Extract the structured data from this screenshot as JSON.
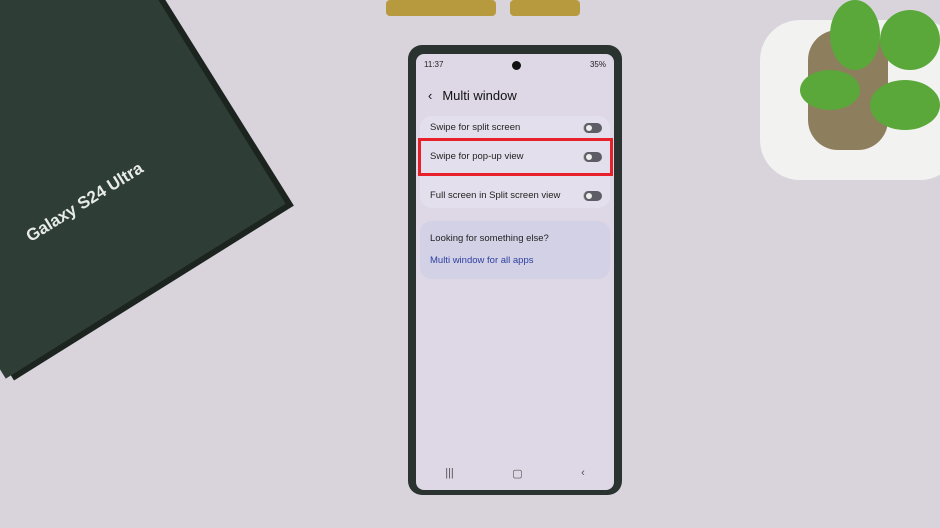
{
  "box": {
    "label": "Galaxy S24 Ultra"
  },
  "status_bar": {
    "time": "11:37",
    "battery": "35%"
  },
  "header": {
    "back_icon": "chevron-left-icon",
    "title": "Multi window"
  },
  "settings": [
    {
      "label": "Swipe for split screen",
      "enabled": false
    },
    {
      "label": "Swipe for pop-up view",
      "enabled": false,
      "highlighted": true
    },
    {
      "label": "Full screen in Split screen view",
      "enabled": false
    }
  ],
  "suggestion": {
    "title": "Looking for something else?",
    "link": "Multi window for all apps"
  },
  "nav": {
    "recents": "|||",
    "home": "▢",
    "back": "‹"
  },
  "colors": {
    "highlight": "#e8202a",
    "link": "#2c3fa0"
  }
}
